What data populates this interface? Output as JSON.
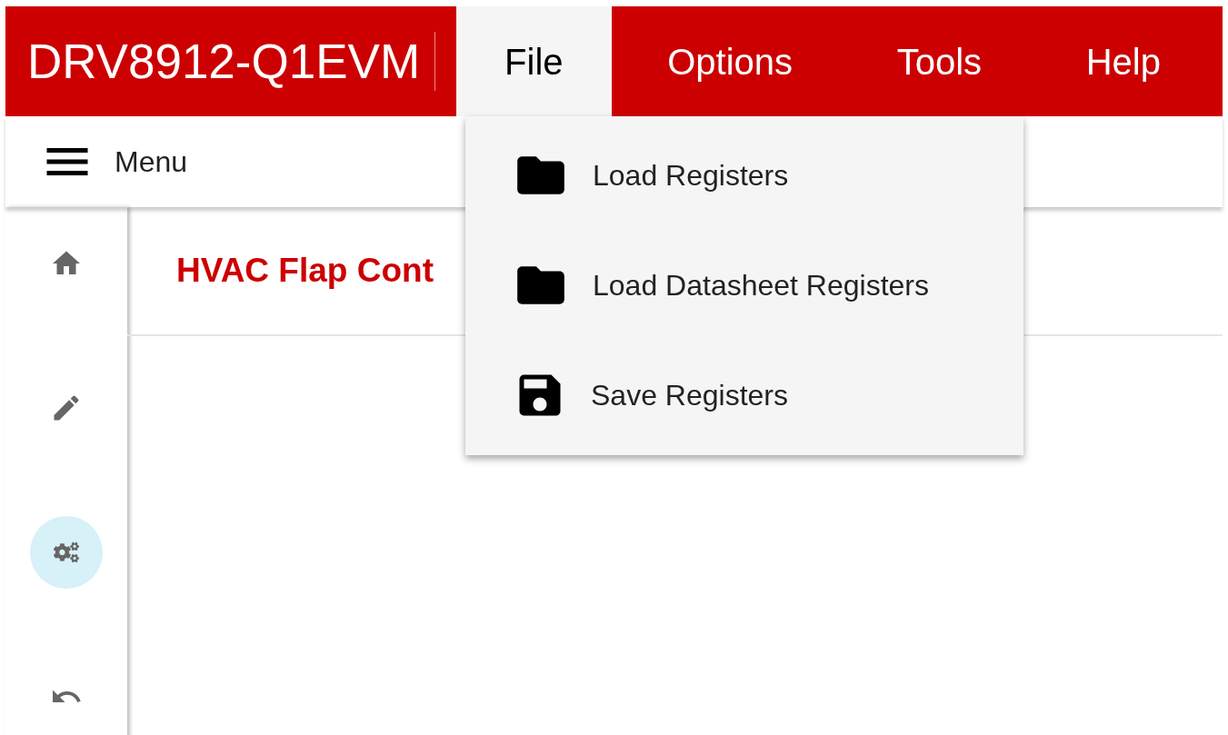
{
  "app_bar": {
    "title": "DRV8912-Q1EVM",
    "menus": [
      {
        "label": "File",
        "selected": true
      },
      {
        "label": "Options",
        "selected": false
      },
      {
        "label": "Tools",
        "selected": false
      },
      {
        "label": "Help",
        "selected": false
      }
    ]
  },
  "toolbar": {
    "menu_label": "Menu"
  },
  "sidebar": {
    "items": [
      {
        "kind": "home",
        "selected": false
      },
      {
        "kind": "edit",
        "selected": false
      },
      {
        "kind": "gears",
        "selected": true
      },
      {
        "kind": "undo",
        "selected": false
      }
    ]
  },
  "content": {
    "heading": "HVAC Flap Cont"
  },
  "file_menu": {
    "items": [
      {
        "label": "Load Registers",
        "kind": "open"
      },
      {
        "label": "Load Datasheet Registers",
        "kind": "open"
      },
      {
        "label": "Save Registers",
        "kind": "save"
      }
    ]
  }
}
